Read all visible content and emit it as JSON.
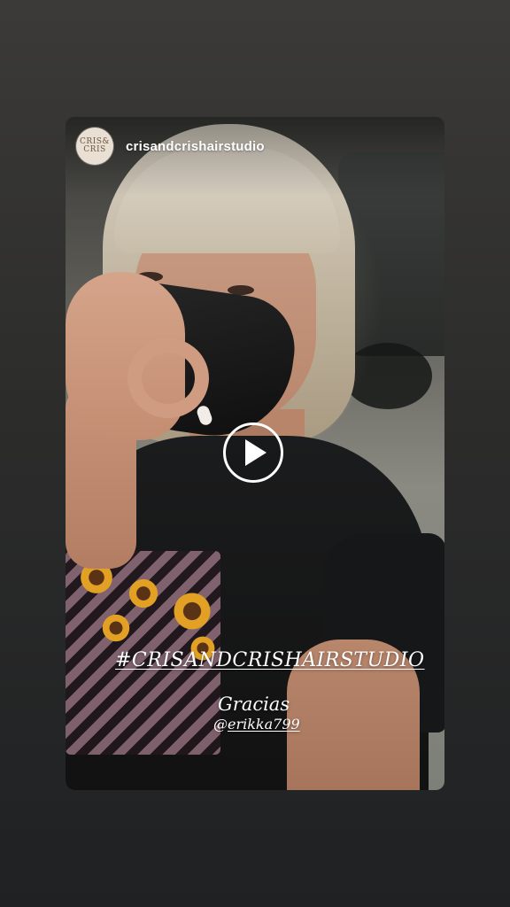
{
  "story": {
    "username": "crisandcrishairstudio",
    "avatar_text": "CRIS& CRIS",
    "hashtag": "#CRISANDCRISHAIRSTUDIO",
    "thanks_text": "Gracias",
    "mention_at": "@",
    "mention_handle": "erikka799"
  },
  "icons": {
    "play": "play-icon"
  },
  "colors": {
    "background_top": "#3b3a38",
    "background_bottom": "#1f2123",
    "overlay_text": "#ffffff"
  }
}
